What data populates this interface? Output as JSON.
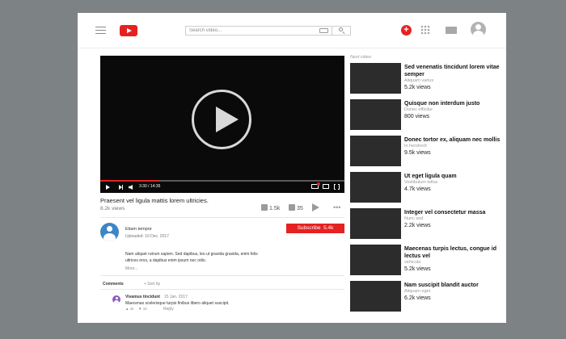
{
  "header": {
    "search_placeholder": "Search video...",
    "upload_glyph": "+"
  },
  "player": {
    "time": "3:30 / 14:35",
    "progress": 0.24
  },
  "video": {
    "title": "Praesent vel ligula mattis lorem ultricies.",
    "views": "8.2k views",
    "likes": "1.5k",
    "dislikes": "35",
    "more_glyph": "•••"
  },
  "channel": {
    "name": "Etiam tempor",
    "uploaded": "Uploaded: 10 Dec. 2017",
    "subscribe_label": "Subscribe",
    "subscribers": "5.4k",
    "description": "Nam aliquet rutrum sapien. Sed dapibus, leo ut gravida gravida, enim felis ultrices eros, a dapibus enim ipsum nec odio.",
    "more_label": "More..."
  },
  "comments": {
    "label": "Comments",
    "sort_label": "+ Sort by",
    "items": [
      {
        "author": "Vivamus tincidunt",
        "date": "15 Jan. 2017",
        "text": "Maecenas scelerisque turpis finibus libero aliquet suscipit.",
        "likes": "1k",
        "dislikes": "10",
        "reply_label": "Reply"
      }
    ]
  },
  "sidebar": {
    "next_label": "Next video",
    "items": [
      {
        "title": "Sed venenatis tincidunt lorem vitae semper",
        "channel": "Aliquam varius",
        "views": "5.2k views"
      },
      {
        "title": "Quisque non interdum justo",
        "channel": "Donec efficitur",
        "views": "800 views"
      },
      {
        "title": "Donec tortor ex, aliquam nec mollis",
        "channel": "In hendrerit",
        "views": "9.5k views"
      },
      {
        "title": "Ut eget ligula quam",
        "channel": "Vestibulum tellus",
        "views": "4.7k views"
      },
      {
        "title": "Integer vel consectetur massa",
        "channel": "Nunc sed",
        "views": "2.2k views"
      },
      {
        "title": "Maecenas turpis lectus, congue id lectus vel",
        "channel": "vehicula",
        "views": "5.2k views"
      },
      {
        "title": "Nam suscipit blandit auctor",
        "channel": "Aliquam eget",
        "views": "6.2k views"
      }
    ]
  },
  "colors": {
    "accent": "#e52222",
    "channel_avatar": "#3d86c6",
    "comment_avatar": "#8b5cbf",
    "thumbnail": "#2c2c2c",
    "background": "#7d8384"
  }
}
